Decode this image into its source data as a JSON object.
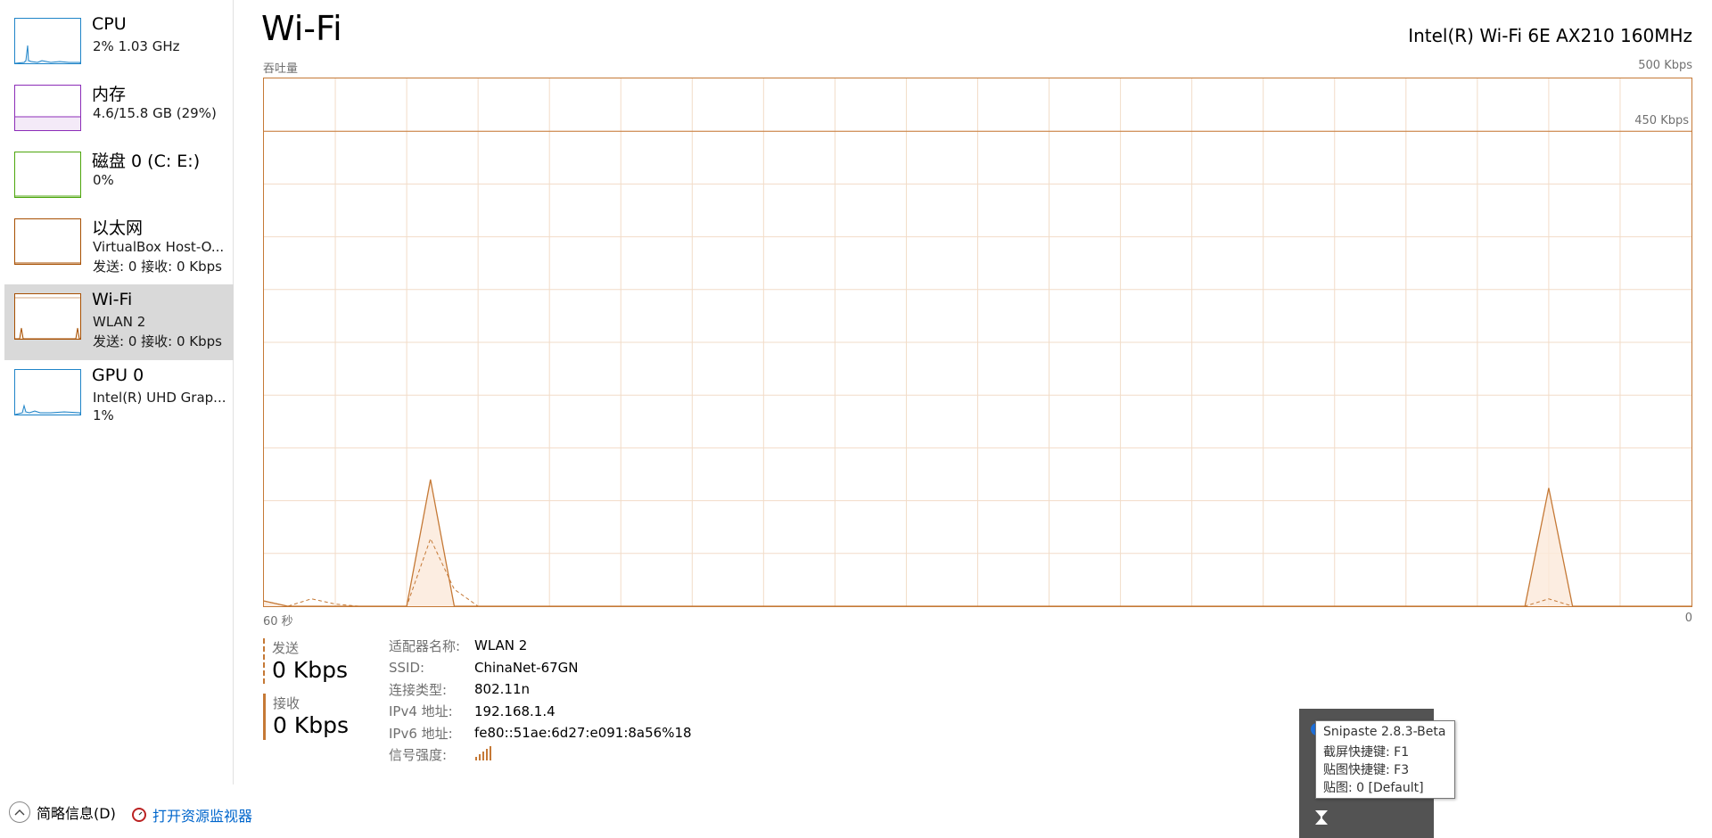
{
  "sidebar": {
    "items": [
      {
        "title": "CPU",
        "line1": "2%  1.03 GHz",
        "line2": ""
      },
      {
        "title": "内存",
        "line1": "4.6/15.8 GB (29%)",
        "line2": ""
      },
      {
        "title": "磁盘 0 (C: E:)",
        "line1": "0%",
        "line2": ""
      },
      {
        "title": "以太网",
        "line1": "VirtualBox Host-O...",
        "line2": "发送: 0 接收: 0 Kbps"
      },
      {
        "title": "Wi-Fi",
        "line1": "WLAN 2",
        "line2": "发送: 0 接收: 0 Kbps"
      },
      {
        "title": "GPU 0",
        "line1": "Intel(R) UHD Grap...",
        "line2": "1%"
      }
    ],
    "colors": {
      "cpu": "#1f84c8",
      "memory": "#8c2db8",
      "disk": "#4da60c",
      "network": "#a74f01"
    }
  },
  "header": {
    "title": "Wi-Fi",
    "adapter": "Intel(R) Wi-Fi 6E AX210 160MHz"
  },
  "chart": {
    "y_label": "吞吐量",
    "y_max_label": "500 Kbps",
    "scale_line_label": "450 Kbps",
    "x_left_label": "60 秒",
    "x_right_label": "0"
  },
  "chart_data": {
    "type": "area",
    "title": "",
    "xlabel": "",
    "ylabel": "吞吐量",
    "x_unit": "seconds ago",
    "xlim": [
      60,
      0
    ],
    "ylim": [
      0,
      500
    ],
    "grid": true,
    "x": [
      60,
      59,
      58,
      57,
      56,
      55,
      54,
      53,
      52,
      51,
      50,
      49,
      48,
      47,
      46,
      45,
      40,
      30,
      20,
      10,
      8,
      7,
      6,
      5,
      4,
      3,
      2,
      1,
      0
    ],
    "series": [
      {
        "name": "接收",
        "values": [
          5,
          0,
          0,
          0,
          0,
          0,
          0,
          120,
          0,
          0,
          0,
          0,
          0,
          0,
          0,
          0,
          0,
          0,
          0,
          0,
          0,
          0,
          112,
          0,
          0,
          0,
          0,
          0,
          0
        ]
      },
      {
        "name": "发送",
        "values": [
          5,
          0,
          7,
          2,
          0,
          0,
          0,
          64,
          16,
          0,
          0,
          0,
          0,
          0,
          0,
          0,
          0,
          0,
          0,
          0,
          0,
          0,
          7,
          0,
          0,
          0,
          0,
          0,
          0
        ]
      }
    ]
  },
  "stats": {
    "send_label": "发送",
    "send_value": "0 Kbps",
    "recv_label": "接收",
    "recv_value": "0 Kbps"
  },
  "props": [
    {
      "key": "适配器名称:",
      "value": "WLAN 2"
    },
    {
      "key": "SSID:",
      "value": "ChinaNet-67GN"
    },
    {
      "key": "连接类型:",
      "value": "802.11n"
    },
    {
      "key": "IPv4 地址:",
      "value": "192.168.1.4"
    },
    {
      "key": "IPv6 地址:",
      "value": "fe80::51ae:6d27:e091:8a56%18"
    },
    {
      "key": "信号强度:",
      "value": ""
    }
  ],
  "signal_bars": 5,
  "footer": {
    "fewer_details": "简略信息(D)",
    "open_monitor": "打开资源监视器"
  },
  "tooltip": {
    "lines": [
      "Snipaste 2.8.3-Beta",
      "截屏快捷键: F1",
      "贴图快捷键: F3",
      "贴图: 0 [Default]"
    ]
  }
}
